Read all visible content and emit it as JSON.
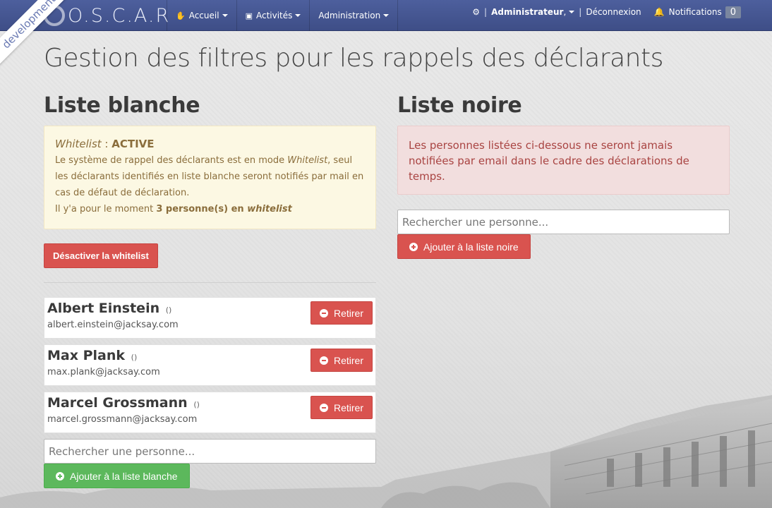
{
  "brand": {
    "name": "O.S.C.A.R",
    "env_ribbon": "development"
  },
  "nav": {
    "items": [
      {
        "label": "Accueil",
        "icon": "hand-icon"
      },
      {
        "label": "Activités",
        "icon": "cube-icon"
      },
      {
        "label": "Administration",
        "icon": ""
      }
    ]
  },
  "user_nav": {
    "user": "Administrateur",
    "logout": "Déconnexion",
    "notifications_label": "Notifications",
    "notifications_count": "0"
  },
  "page": {
    "title": "Gestion des filtres pour les rappels des déclarants"
  },
  "whitelist": {
    "title": "Liste blanche",
    "status_word": "Whitelist",
    "status_sep": " : ",
    "status_value": "ACTIVE",
    "desc_1": "Le système de rappel des déclarants est en mode ",
    "desc_mode": "Whitelist",
    "desc_2": ", seul les déclarants identifiés en liste blanche seront notifiés par mail en cas de défaut de déclaration.",
    "count_prefix": "Il y'a pour le moment ",
    "count_value": "3 personne(s) en ",
    "count_word": "whitelist",
    "deactivate_button": "Désactiver la whitelist",
    "people": [
      {
        "name": "Albert Einstein",
        "paren": "()",
        "email": "albert.einstein@jacksay.com",
        "remove": "Retirer"
      },
      {
        "name": "Max Plank",
        "paren": "()",
        "email": "max.plank@jacksay.com",
        "remove": "Retirer"
      },
      {
        "name": "Marcel Grossmann",
        "paren": "()",
        "email": "marcel.grossmann@jacksay.com",
        "remove": "Retirer"
      }
    ],
    "search_placeholder": "Rechercher une personne...",
    "add_button": "Ajouter à la liste blanche"
  },
  "blacklist": {
    "title": "Liste noire",
    "info": "Les personnes listées ci-dessous ne seront jamais notifiées par email dans le cadre des déclarations de temps.",
    "search_placeholder": "Rechercher une personne...",
    "add_button": "Ajouter à la liste noire"
  },
  "colors": {
    "topbar": "#4d5f9d",
    "danger": "#d9534f",
    "success": "#5cb85c",
    "warning_bg": "#fcf8e3",
    "danger_bg": "#f2dede"
  }
}
